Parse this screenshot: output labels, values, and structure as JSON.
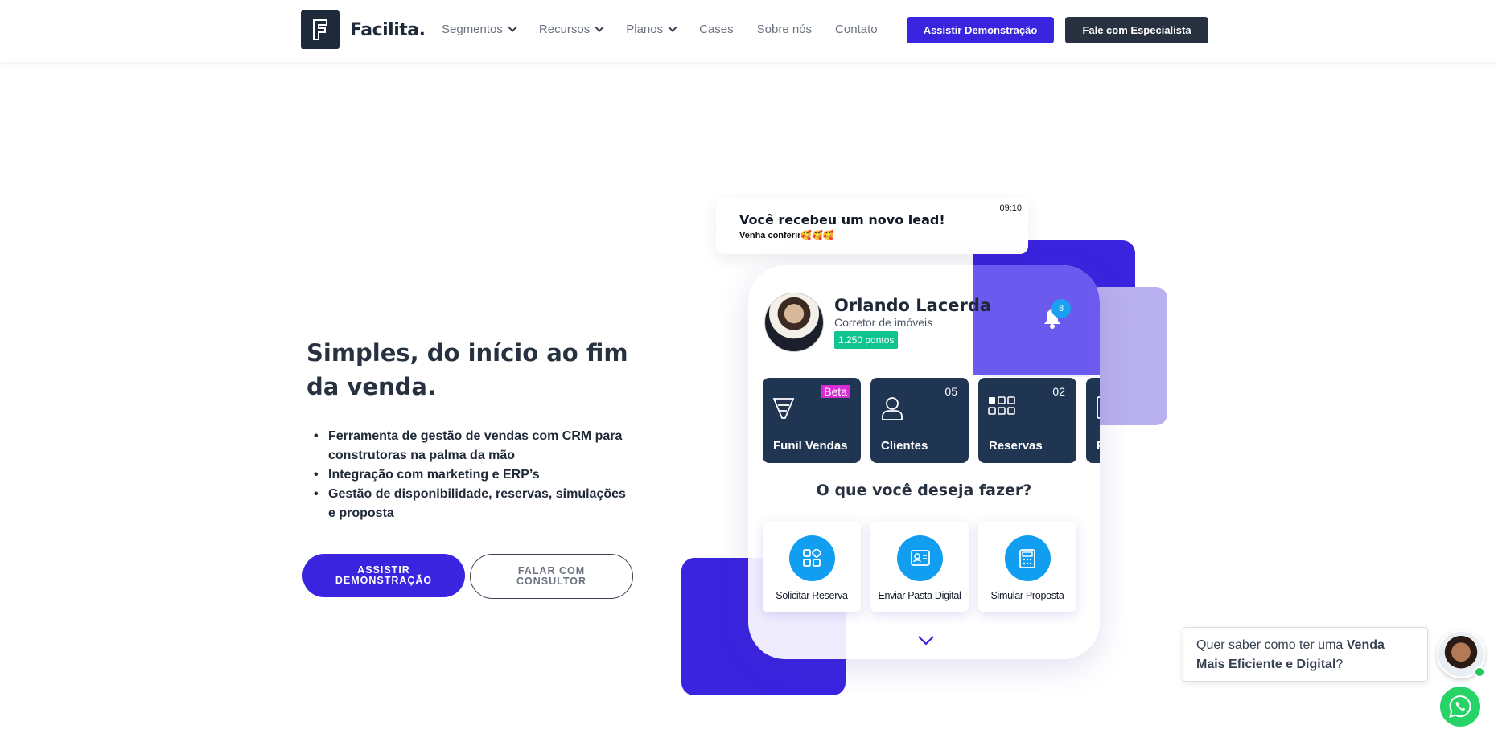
{
  "header": {
    "brand": "Facilita.",
    "nav": [
      {
        "label": "Segmentos",
        "dropdown": true
      },
      {
        "label": "Recursos",
        "dropdown": true
      },
      {
        "label": "Planos",
        "dropdown": true
      },
      {
        "label": "Cases",
        "dropdown": false
      },
      {
        "label": "Sobre nós",
        "dropdown": false
      },
      {
        "label": "Contato",
        "dropdown": false
      }
    ],
    "demo_button": "Assistir Demonstração",
    "specialist_button": "Fale com Especialista"
  },
  "hero": {
    "title": "Simples, do início ao fim da venda.",
    "bullets": [
      "Ferramenta de gestão de vendas com CRM para construtoras na palma da mão",
      "Integração com marketing e ERP’s",
      "Gestão de disponibilidade, reservas, simulações e proposta"
    ],
    "primary_cta_line1": "ASSISTIR",
    "primary_cta_line2": "DEMONSTRAÇÃO",
    "secondary_cta_line1": "FALAR COM",
    "secondary_cta_line2": "CONSULTOR"
  },
  "notification": {
    "time": "09:10",
    "title": "Você recebeu um novo lead!",
    "subtitle": "Venha conferir🥰🥰🥰"
  },
  "phone": {
    "user_name": "Orlando Lacerda",
    "user_role": "Corretor de imóveis",
    "points": "1.250 pontos",
    "bell_count": "8",
    "tiles": [
      {
        "label": "Funil Vendas",
        "badge": "Beta",
        "icon": "funnel-icon"
      },
      {
        "label": "Clientes",
        "count": "05",
        "icon": "user-icon"
      },
      {
        "label": "Reservas",
        "count": "02",
        "icon": "grid-icon"
      },
      {
        "label": "P",
        "icon": "document-icon"
      }
    ],
    "question": "O que você deseja fazer?",
    "actions": [
      {
        "label": "Solicitar Reserva",
        "icon": "apps-icon"
      },
      {
        "label": "Enviar Pasta Digital",
        "icon": "id-card-icon"
      },
      {
        "label": "Simular Proposta",
        "icon": "calculator-icon"
      }
    ]
  },
  "chat": {
    "text_prefix": "Quer saber como ter uma ",
    "text_bold": "Venda Mais Eficiente e Digital",
    "text_suffix": "?"
  },
  "colors": {
    "primary": "#3b24e0",
    "dark": "#27313f",
    "tile": "#1f3552",
    "points": "#10c48f",
    "action_circle": "#129ef0",
    "whatsapp": "#25d366"
  }
}
